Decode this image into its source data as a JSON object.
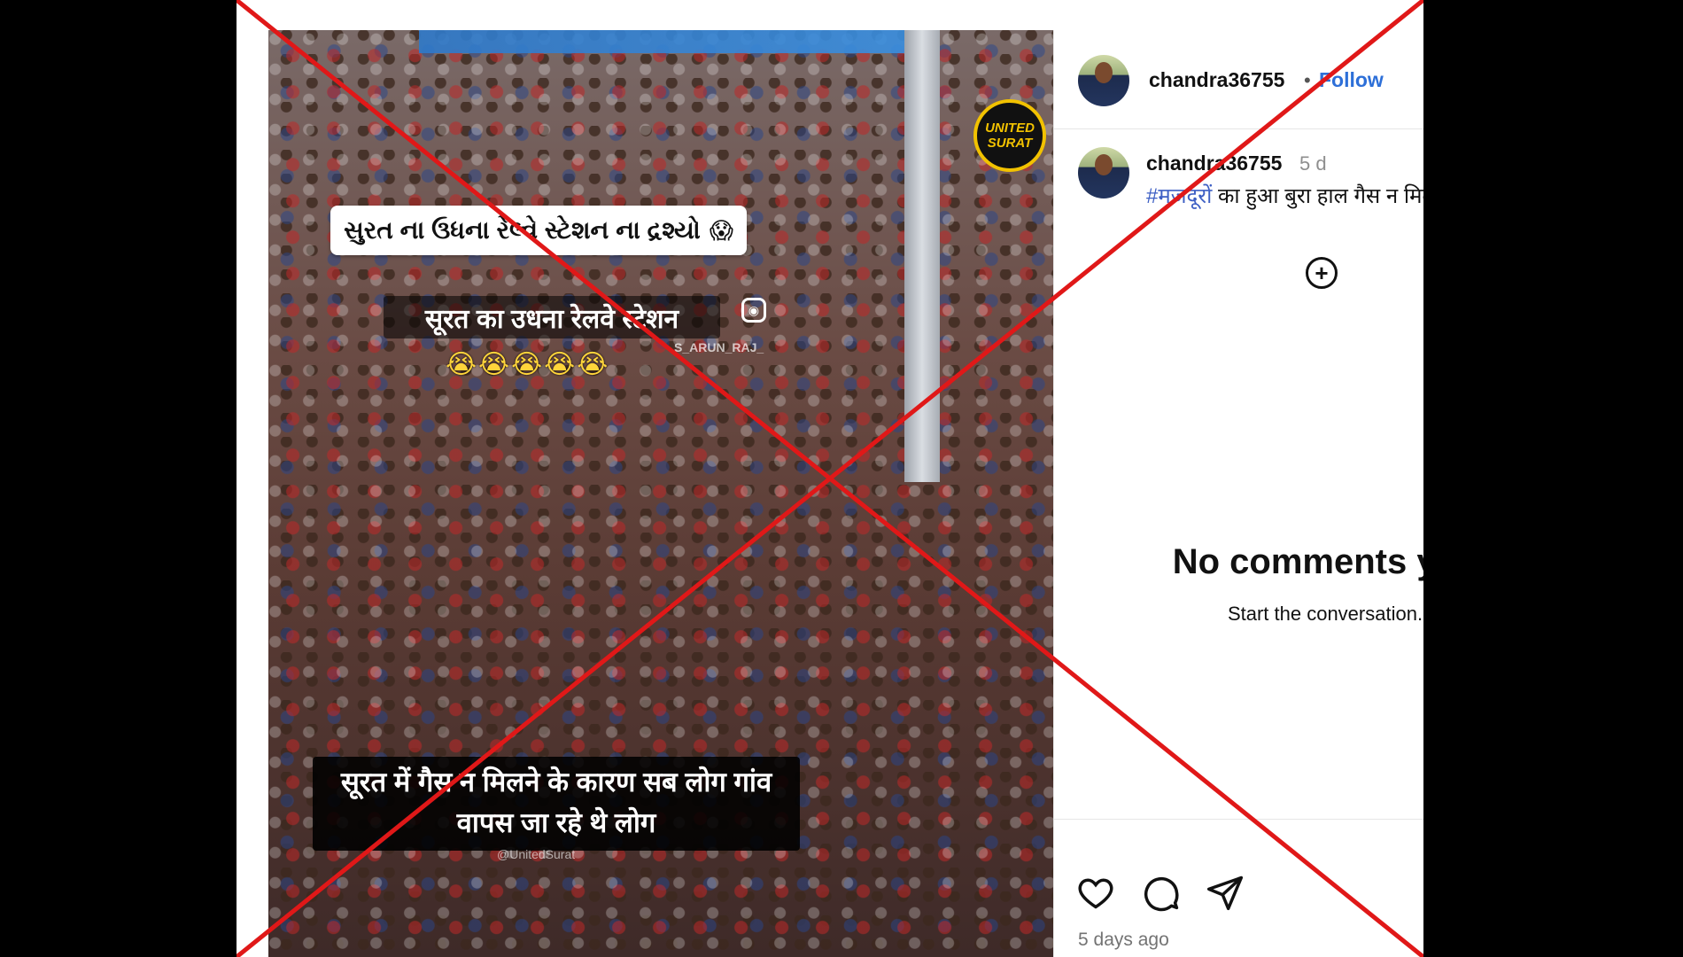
{
  "media": {
    "logo_text": "UNITED\nSURAT",
    "gujarati_banner": "સુરત ના ઉધના રેલ્વે સ્ટેશન ના દ્રશ્યો",
    "gujarati_emoji": "😱",
    "hindi_banner": "सूरत का उधना रेलवे स्टेशन",
    "emoji_row": "😭😭😭😭😭",
    "watermark_top": "S_ARUN_RAJ_",
    "caption": "सूरत में गैस न मिलने के कारण सब लोग गांव वापस जा रहे थे लोग",
    "watermark_bottom": "@UnitedSurat"
  },
  "header": {
    "username": "chandra36755",
    "separator": "•",
    "follow_label": "Follow",
    "more_label": "···"
  },
  "post": {
    "username": "chandra36755",
    "age": "5 d",
    "hashtag": "#मजदूरों",
    "text": " का हुआ बुरा हाल गैस न मिलने पर"
  },
  "comments": {
    "add_icon": "+",
    "empty_title": "No comments yet.",
    "empty_subtitle": "Start the conversation."
  },
  "actions": {
    "timestamp": "5 days ago"
  },
  "colors": {
    "follow": "#2d6fd8",
    "hashtag": "#3d5fc4",
    "cross": "#e01818"
  }
}
